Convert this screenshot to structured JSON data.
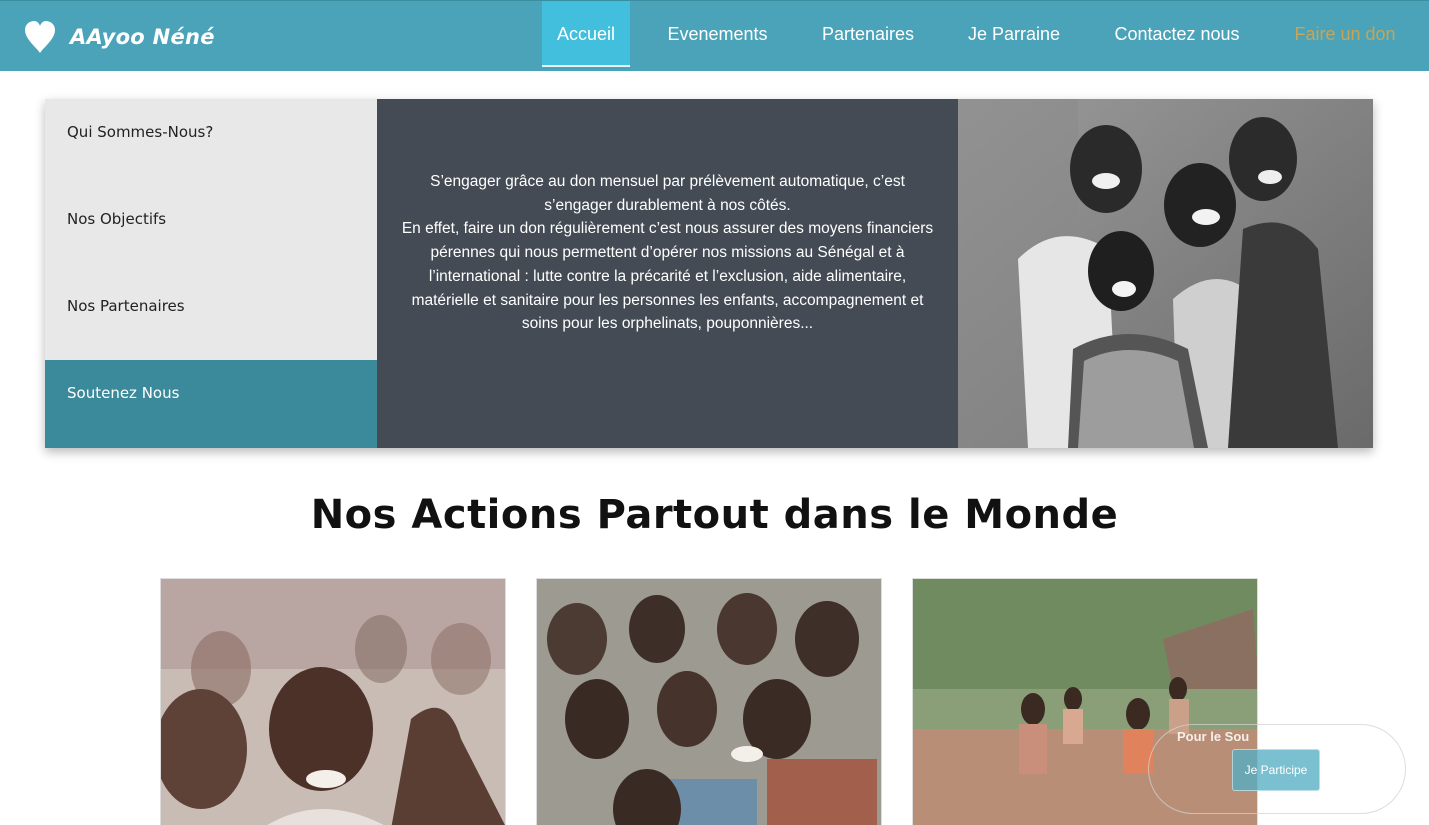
{
  "brand": {
    "name": "AAyoo Néné",
    "icon": "heart-icon"
  },
  "nav": {
    "items": [
      {
        "label": "Accueil",
        "active": true
      },
      {
        "label": "Evenements"
      },
      {
        "label": "Partenaires"
      },
      {
        "label": "Je Parraine"
      },
      {
        "label": "Contactez nous"
      },
      {
        "label": "Faire un don"
      }
    ]
  },
  "sidebar": {
    "items": [
      {
        "label": "Qui Sommes-Nous?"
      },
      {
        "label": "Nos Objectifs"
      },
      {
        "label": "Nos Partenaires"
      },
      {
        "label": "Soutenez Nous",
        "active": true
      }
    ]
  },
  "feature": {
    "paragraph1": "S’engager grâce au don mensuel par prélèvement automatique, c’est s’engager durablement à nos côtés.",
    "paragraph2": "En effet, faire un don régulièrement c’est nous assurer des moyens financiers pérennes qui nous permettent d’opérer nos missions au Sénégal et à l’international : lutte contre la précarité et l’exclusion, aide alimentaire, matérielle et sanitaire pour les personnes les enfants, accompagnement et soins pour les orphelinats, pouponnières..."
  },
  "section": {
    "title": "Nos Actions Partout dans le Monde"
  },
  "floating": {
    "label": "Pour le Sou",
    "button": "Je Participe"
  },
  "colors": {
    "navbar": "#4aa3b8",
    "active_tab": "#41bfdc",
    "gold_link": "#c9a456",
    "sidebar_active": "#3a8a9c",
    "text_panel": "#444b55"
  }
}
